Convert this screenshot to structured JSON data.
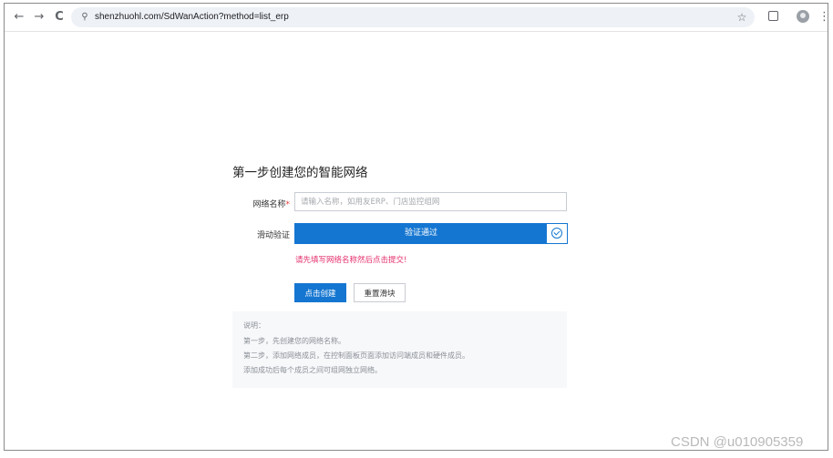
{
  "browser": {
    "url": "shenzhuohl.com/SdWanAction?method=list_erp",
    "icons": [
      "back-icon",
      "forward-icon",
      "reload-icon",
      "site-info-icon",
      "bookmark-star-icon",
      "extensions-icon",
      "profile-avatar",
      "menu-icon"
    ],
    "back_glyph": "←",
    "forward_glyph": "→",
    "reload_glyph": "C",
    "tune_glyph": "⚲",
    "star_glyph": "☆",
    "menu_glyph": "⋮"
  },
  "page": {
    "heading": "第一步创建您的智能网络",
    "network_name": {
      "label": "网络名称",
      "required_mark": "*",
      "placeholder": "请输入名称，如用友ERP、门店监控组网",
      "value": ""
    },
    "slide_verify": {
      "label": "滑动验证",
      "status_text": "验证通过",
      "verified": true
    },
    "warning": "请先填写网络名称然后点击提交!",
    "buttons": {
      "create": "点击创建",
      "reset": "重置滑块"
    },
    "notes": {
      "title": "说明：",
      "lines": [
        "第一步，先创建您的网络名称。",
        "第二步，添加网络成员，在控制面板页面添加访问端成员和硬件成员。",
        "添加成功后每个成员之间可组网独立网络。"
      ]
    }
  },
  "watermark": "CSDN @u010905359",
  "colors": {
    "primary": "#1476d1",
    "warning": "#e5306c",
    "notes_bg": "#f7f8fa"
  }
}
